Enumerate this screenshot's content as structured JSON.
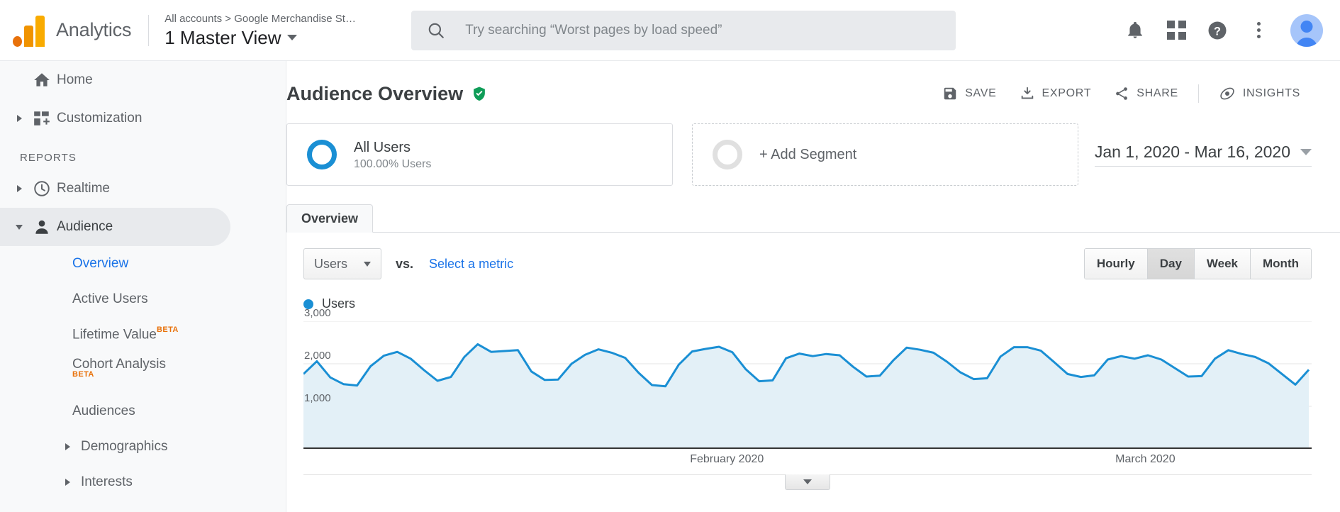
{
  "topbar": {
    "brand": "Analytics",
    "logo_icon": "analytics-logo-icon",
    "breadcrumb": "All accounts > Google Merchandise St…",
    "view_name": "1 Master View",
    "view_caret_icon": "chevron-down-icon",
    "search": {
      "icon": "search-icon",
      "placeholder": "Try searching “Worst pages by load speed”",
      "value": ""
    },
    "icons": {
      "notifications": "bell-icon",
      "apps": "apps-grid-icon",
      "help": "help-circle-icon",
      "more": "more-vertical-icon",
      "account": "avatar"
    }
  },
  "sidebar": {
    "items": [
      {
        "label": "Home",
        "icon": "home-icon",
        "expandable": false,
        "selected": false
      },
      {
        "label": "Customization",
        "icon": "customization-icon",
        "expandable": true,
        "selected": false
      }
    ],
    "section_label": "REPORTS",
    "reports": [
      {
        "label": "Realtime",
        "icon": "clock-icon",
        "expandable": true,
        "selected": false
      },
      {
        "label": "Audience",
        "icon": "person-icon",
        "expandable": true,
        "selected": true
      }
    ],
    "audience_children": [
      {
        "label": "Overview",
        "selected": true,
        "badge": "",
        "badge_pos": ""
      },
      {
        "label": "Active Users",
        "selected": false,
        "badge": "",
        "badge_pos": ""
      },
      {
        "label": "Lifetime Value",
        "selected": false,
        "badge": "BETA",
        "badge_pos": "sup"
      },
      {
        "label": "Cohort Analysis",
        "selected": false,
        "badge": "BETA",
        "badge_pos": "below"
      },
      {
        "label": "Audiences",
        "selected": false,
        "badge": "",
        "badge_pos": ""
      },
      {
        "label": "Demographics",
        "selected": false,
        "badge": "",
        "badge_pos": "",
        "expandable": true
      },
      {
        "label": "Interests",
        "selected": false,
        "badge": "",
        "badge_pos": "",
        "expandable": true
      }
    ]
  },
  "main": {
    "page_title": "Audience Overview",
    "verified_icon": "shield-check-icon",
    "actions": [
      {
        "label": "SAVE",
        "icon": "save-icon"
      },
      {
        "label": "EXPORT",
        "icon": "export-download-icon"
      },
      {
        "label": "SHARE",
        "icon": "share-icon"
      },
      {
        "label": "INSIGHTS",
        "icon": "insights-icon"
      }
    ],
    "segments": [
      {
        "title": "All Users",
        "subtitle": "100.00% Users",
        "ring_color": "#1a8fd4"
      }
    ],
    "add_segment_label": "+ Add Segment",
    "date_range": "Jan 1, 2020 - Mar 16, 2020",
    "date_caret_icon": "chevron-down-icon",
    "tabs": [
      {
        "label": "Overview",
        "active": true
      }
    ],
    "metric_select": {
      "value": "Users",
      "caret_icon": "chevron-down-icon"
    },
    "vs_label": "vs.",
    "select_metric_link": "Select a metric",
    "granularity": [
      {
        "label": "Hourly",
        "active": false
      },
      {
        "label": "Day",
        "active": true
      },
      {
        "label": "Week",
        "active": false
      },
      {
        "label": "Month",
        "active": false
      }
    ],
    "collapse_icon": "collapse-triangle-icon"
  },
  "chart_data": {
    "type": "area",
    "title": "",
    "legend": [
      {
        "name": "Users",
        "color": "#1a8fd4"
      }
    ],
    "legend_position": "top-left",
    "xlabel": "",
    "ylabel": "",
    "ylim": [
      0,
      3000
    ],
    "yticks": [
      1000,
      2000,
      3000
    ],
    "ytick_labels": [
      "1,000",
      "2,000",
      "3,000"
    ],
    "grid": true,
    "line_color": "#1a8fd4",
    "fill_color": "#e3f0f7",
    "x_axis_labels": [
      {
        "label": "February 2020",
        "position_pct": 42.0
      },
      {
        "label": "March 2020",
        "position_pct": 83.5
      }
    ],
    "x_start": "Jan 1, 2020",
    "x_end": "Mar 16, 2020",
    "series": [
      {
        "name": "Users",
        "color": "#1a8fd4",
        "values": [
          1760,
          2060,
          1680,
          1520,
          1490,
          1940,
          2190,
          2280,
          2120,
          1850,
          1600,
          1690,
          2160,
          2460,
          2280,
          2300,
          2320,
          1820,
          1620,
          1630,
          2000,
          2210,
          2340,
          2260,
          2140,
          1790,
          1500,
          1470,
          1980,
          2290,
          2350,
          2400,
          2270,
          1870,
          1590,
          1610,
          2130,
          2240,
          2180,
          2230,
          2200,
          1930,
          1700,
          1720,
          2080,
          2380,
          2330,
          2260,
          2050,
          1800,
          1640,
          1660,
          2170,
          2390,
          2390,
          2310,
          2040,
          1760,
          1690,
          1730,
          2100,
          2180,
          2120,
          2200,
          2100,
          1900,
          1700,
          1710,
          2120,
          2320,
          2230,
          2160,
          2010,
          1760,
          1510,
          1860
        ]
      }
    ]
  }
}
